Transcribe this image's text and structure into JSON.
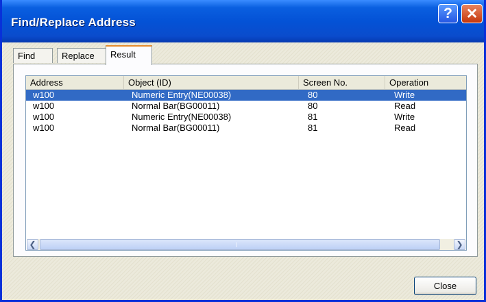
{
  "window": {
    "title": "Find/Replace Address"
  },
  "titlebar_buttons": {
    "help": "?",
    "close": "✕"
  },
  "tabs": [
    {
      "label": "Find"
    },
    {
      "label": "Replace"
    },
    {
      "label": "Result"
    }
  ],
  "active_tab": "Result",
  "table": {
    "columns": [
      "Address",
      "Object (ID)",
      "Screen No.",
      "Operation"
    ],
    "rows": [
      {
        "address": "w100",
        "object": "Numeric Entry(NE00038)",
        "screen": "80",
        "operation": "Write",
        "selected": true
      },
      {
        "address": "w100",
        "object": "Normal Bar(BG00011)",
        "screen": "80",
        "operation": "Read",
        "selected": false
      },
      {
        "address": "w100",
        "object": "Numeric Entry(NE00038)",
        "screen": "81",
        "operation": "Write",
        "selected": false
      },
      {
        "address": "w100",
        "object": "Normal Bar(BG00011)",
        "screen": "81",
        "operation": "Read",
        "selected": false
      }
    ]
  },
  "scrollbar": {
    "left_arrow": "❮",
    "right_arrow": "❯"
  },
  "buttons": {
    "close": "Close"
  },
  "colors": {
    "title_bar": "#0452d6",
    "selection": "#316ac5",
    "active_tab_accent": "#e68b2c"
  }
}
